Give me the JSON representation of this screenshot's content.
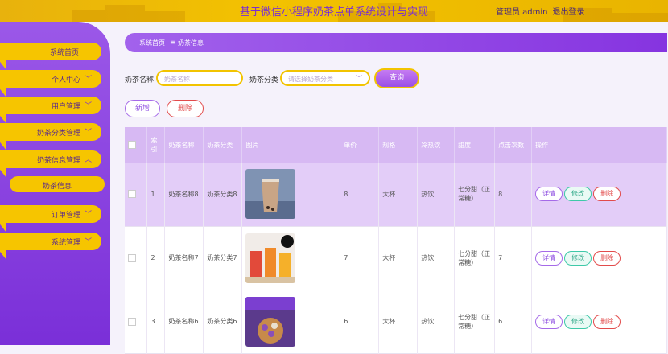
{
  "header": {
    "title": "基于微信小程序奶茶点单系统设计与实现",
    "admin_label": "管理员 admin",
    "logout": "退出登录"
  },
  "sidebar": {
    "items": [
      {
        "label": "系统首页",
        "expand": false
      },
      {
        "label": "个人中心",
        "expand": true
      },
      {
        "label": "用户管理",
        "expand": true
      },
      {
        "label": "奶茶分类管理",
        "expand": true
      },
      {
        "label": "奶茶信息管理",
        "expand": true,
        "open": true
      },
      {
        "label": "奶茶信息",
        "sub": true
      },
      {
        "label": "订单管理",
        "expand": true
      },
      {
        "label": "系统管理",
        "expand": true
      }
    ]
  },
  "breadcrumb": {
    "home": "系统首页",
    "sep": "≡",
    "current": "奶茶信息"
  },
  "search": {
    "name_label": "奶茶名称",
    "name_placeholder": "奶茶名称",
    "cat_label": "奶茶分类",
    "cat_placeholder": "请选择奶茶分类",
    "query": "查询"
  },
  "actions": {
    "add": "新增",
    "delete": "删除"
  },
  "table": {
    "headers": [
      "索引",
      "奶茶名称",
      "奶茶分类",
      "图片",
      "单价",
      "规格",
      "冷热饮",
      "甜度",
      "点击次数",
      "操作"
    ],
    "rows": [
      {
        "index": "1",
        "name": "奶茶名称8",
        "category": "奶茶分类8",
        "price": "8",
        "spec": "大杯",
        "temp": "热饮",
        "sweet": "七分甜（正常糖）",
        "clicks": "8",
        "selected": true
      },
      {
        "index": "2",
        "name": "奶茶名称7",
        "category": "奶茶分类7",
        "price": "7",
        "spec": "大杯",
        "temp": "热饮",
        "sweet": "七分甜（正常糖）",
        "clicks": "7",
        "selected": false
      },
      {
        "index": "3",
        "name": "奶茶名称6",
        "category": "奶茶分类6",
        "price": "6",
        "spec": "大杯",
        "temp": "热饮",
        "sweet": "七分甜（正常糖）",
        "clicks": "6",
        "selected": false
      }
    ],
    "ops": {
      "detail": "详情",
      "edit": "修改",
      "remove": "删除"
    }
  },
  "colors": {
    "accent": "#8634e0",
    "yellow": "#f6c500",
    "danger": "#e24b4b",
    "teal": "#3ec9a8"
  }
}
